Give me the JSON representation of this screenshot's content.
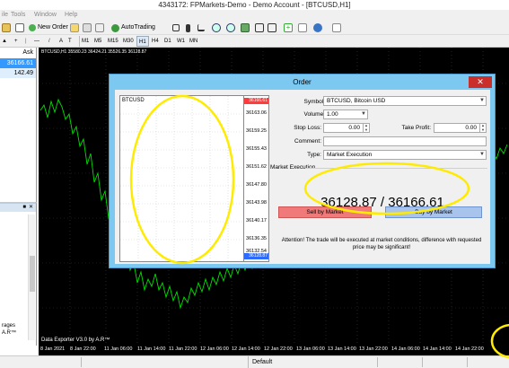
{
  "window": {
    "title": "4343172: FPMarkets-Demo - Demo Account - [BTCUSD,H1]"
  },
  "menu": [
    "ile",
    "Tools",
    "Window",
    "Help"
  ],
  "toolbar": {
    "new_order": "New Order",
    "auto_trading": "AutoTrading",
    "timeframes": [
      "M1",
      "M5",
      "M15",
      "M30",
      "H1",
      "H4",
      "D1",
      "W1",
      "MN"
    ]
  },
  "market_watch": {
    "header": "Ask",
    "rows": [
      "36166.61",
      "142.49"
    ]
  },
  "navigator": {
    "texts": [
      "rages",
      "A.R™"
    ]
  },
  "chart": {
    "title": "BTCUSD,H1  35580.23 36424.21 35526.35 36128.87",
    "exporter": "Data Exporter V3.0 by A.R™",
    "x_labels": [
      "8 Jan 2021",
      "8 Jan 22:00",
      "11 Jan 06:00",
      "11 Jan 14:00",
      "11 Jan 22:00",
      "12 Jan 06:00",
      "12 Jan 14:00",
      "12 Jan 22:00",
      "13 Jan 06:00",
      "13 Jan 14:00",
      "13 Jan 22:00",
      "14 Jan 06:00",
      "14 Jan 14:00",
      "14 Jan 22:00"
    ]
  },
  "status": {
    "profile": "Default"
  },
  "order": {
    "title": "Order",
    "close": "✕",
    "symbol_label": "Symbol:",
    "symbol_value": "BTCUSD, Bitcoin USD",
    "volume_label": "Volume:",
    "volume_value": "1.00",
    "stop_loss_label": "Stop Loss:",
    "stop_loss_value": "0.00",
    "take_profit_label": "Take Profit:",
    "take_profit_value": "0.00",
    "comment_label": "Comment:",
    "comment_value": "",
    "type_label": "Type:",
    "type_value": "Market Execution",
    "group_label": "Market Execution",
    "price": "36128.87 / 36166.61",
    "sell_label": "Sell by Market",
    "buy_label": "Buy by Market",
    "attention": "Attention! The trade will be executed at market conditions, difference with requested price may be significant!",
    "mini_chart": {
      "symbol": "BTCUSD",
      "bid_tag": "36166.61",
      "ask_tag": "36128.87",
      "prices": [
        "36163.06",
        "36159.25",
        "36155.43",
        "36151.62",
        "36147.80",
        "36143.98",
        "36140.17",
        "36136.35",
        "36132.54"
      ]
    }
  },
  "colors": {
    "chart_bg": "#000000",
    "chart_line": "#00e000",
    "dialog_frame": "#7cc8f0",
    "sell": "#f07a7a",
    "buy": "#a8c4ec",
    "annotation": "#ffeb00"
  }
}
